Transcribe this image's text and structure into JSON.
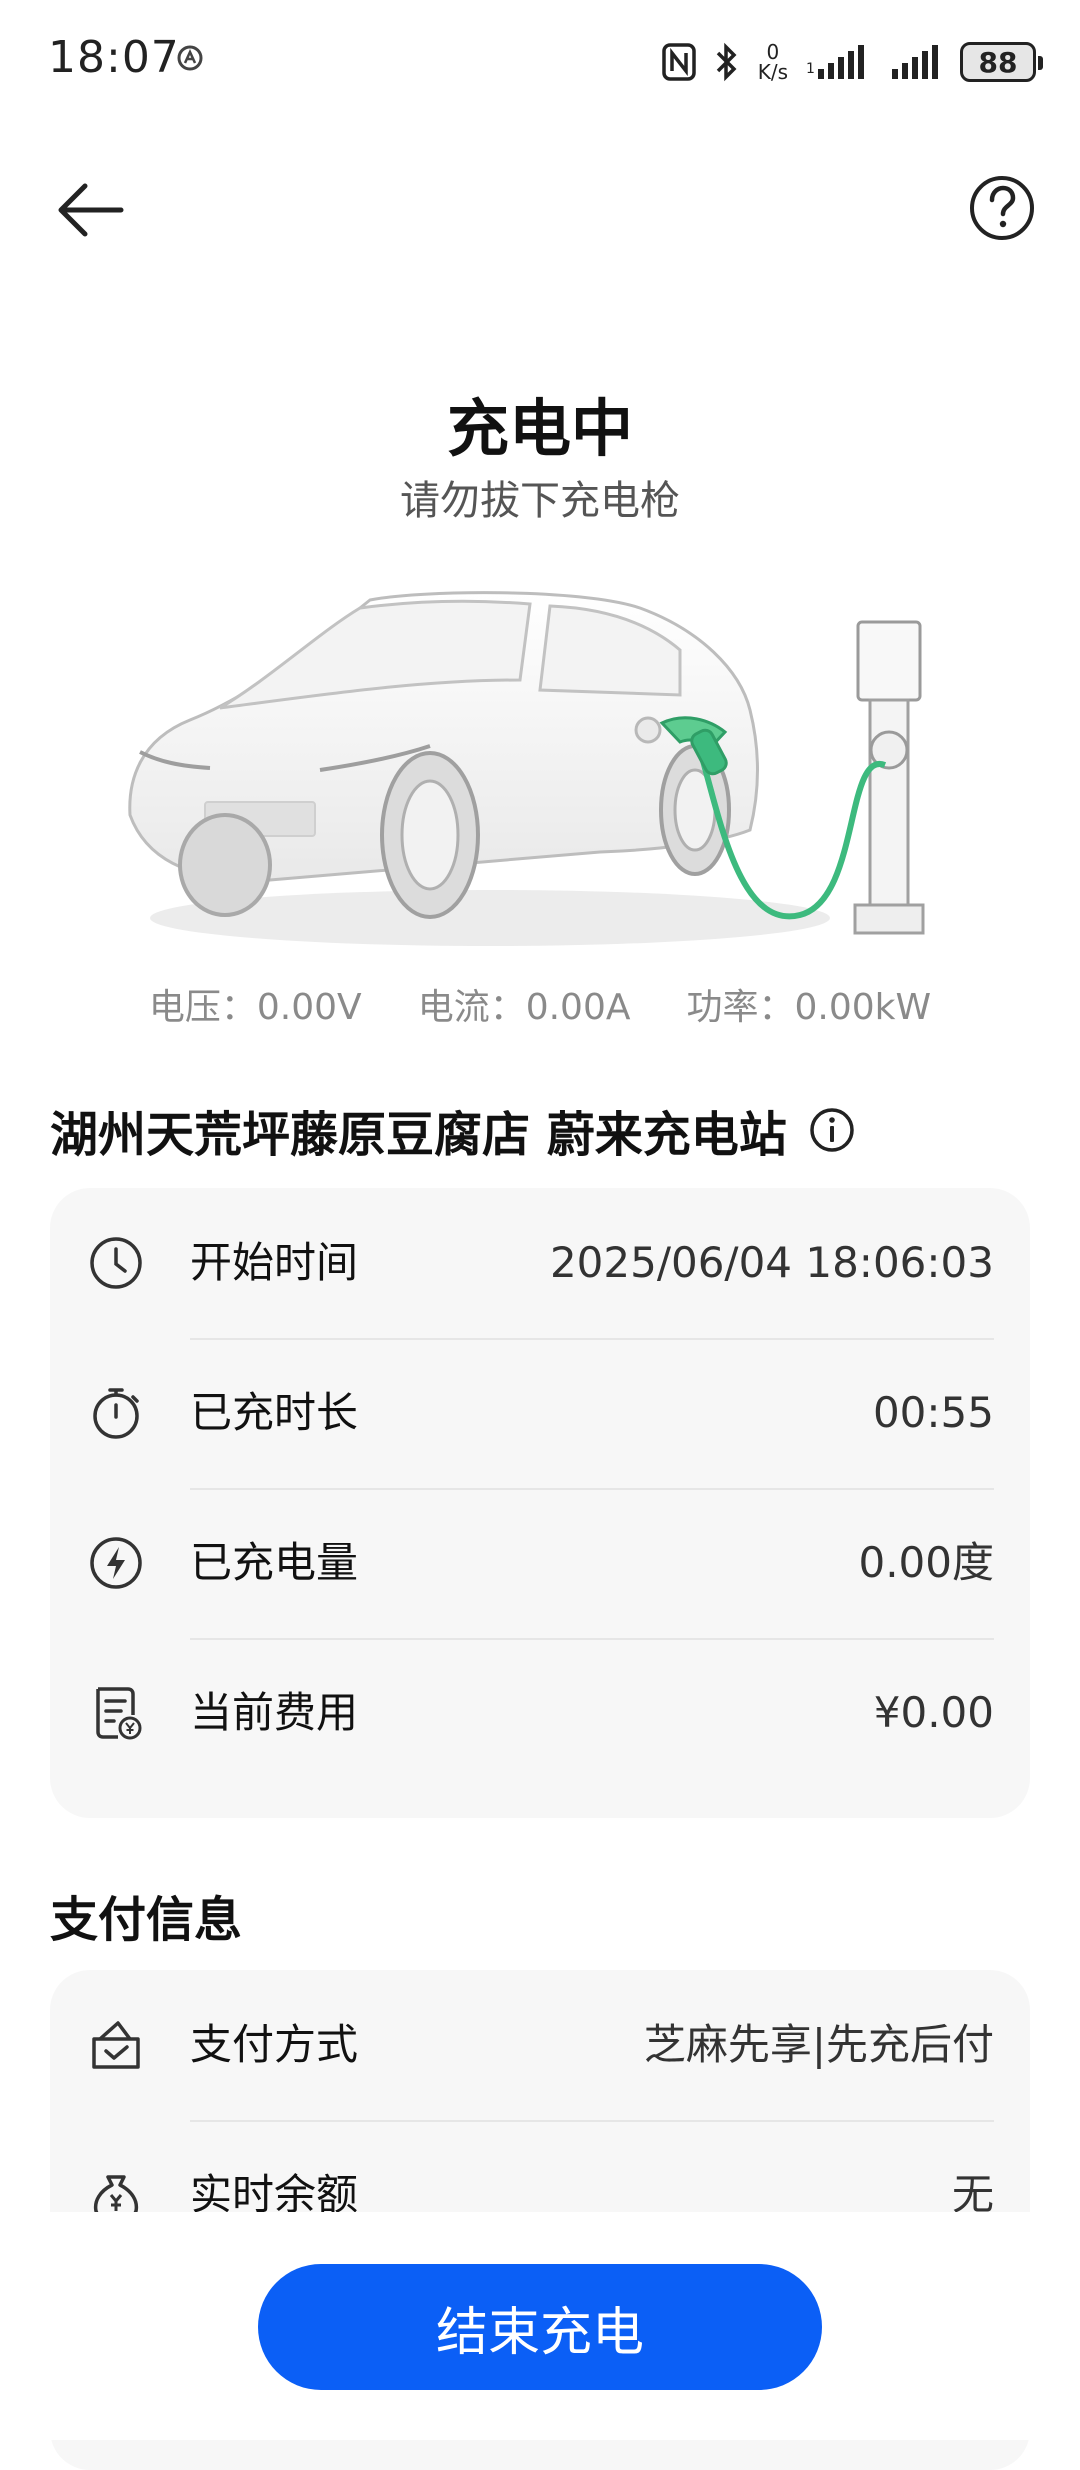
{
  "status_bar": {
    "time": "18:07",
    "net_speed_value": "0",
    "net_speed_unit": "K/s",
    "battery": "88",
    "icons": [
      "nfc-icon",
      "bluetooth-icon",
      "signal-icon",
      "signal-icon",
      "battery-icon"
    ]
  },
  "header": {
    "back_icon": "back-arrow-icon",
    "help_icon": "help-icon"
  },
  "charging": {
    "title": "充电中",
    "subtitle": "请勿拔下充电枪",
    "voltage": "电压：0.00V",
    "current": "电流：0.00A",
    "power": "功率：0.00kW"
  },
  "station": {
    "name": "湖州天荒坪藤原豆腐店 蔚来充电站",
    "icon": "info-icon"
  },
  "details": [
    {
      "icon": "clock-icon",
      "label": "开始时间",
      "value": "2025/06/04 18:06:03"
    },
    {
      "icon": "stopwatch-icon",
      "label": "已充时长",
      "value": "00:55"
    },
    {
      "icon": "lightning-icon",
      "label": "已充电量",
      "value": "0.00度"
    },
    {
      "icon": "receipt-icon",
      "label": "当前费用",
      "value": "¥0.00"
    }
  ],
  "payment": {
    "title": "支付信息",
    "rows": [
      {
        "icon": "wallet-check-icon",
        "label": "支付方式",
        "value": "芝麻先享|先充后付"
      },
      {
        "icon": "money-bag-icon",
        "label": "实时余额",
        "value": "无"
      }
    ]
  },
  "action": {
    "end_label": "结束充电",
    "color": "#0b5ff6"
  },
  "accent_green": "#3dba7e"
}
